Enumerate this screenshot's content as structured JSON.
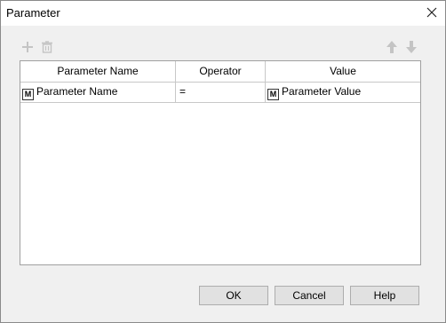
{
  "window": {
    "title": "Parameter"
  },
  "toolbar": {
    "add_icon": "plus-icon",
    "delete_icon": "trash-icon",
    "up_icon": "arrow-up-icon",
    "down_icon": "arrow-down-icon"
  },
  "table": {
    "columns": [
      "Parameter Name",
      "Operator",
      "Value"
    ],
    "rows": [
      {
        "name_badge": "M",
        "name": "Parameter Name",
        "operator": "=",
        "value_badge": "M",
        "value": "Parameter Value"
      }
    ]
  },
  "buttons": {
    "ok": "OK",
    "cancel": "Cancel",
    "help": "Help"
  },
  "colors": {
    "disabled_icon": "#c8c8c8",
    "border": "#a0a0a0"
  }
}
